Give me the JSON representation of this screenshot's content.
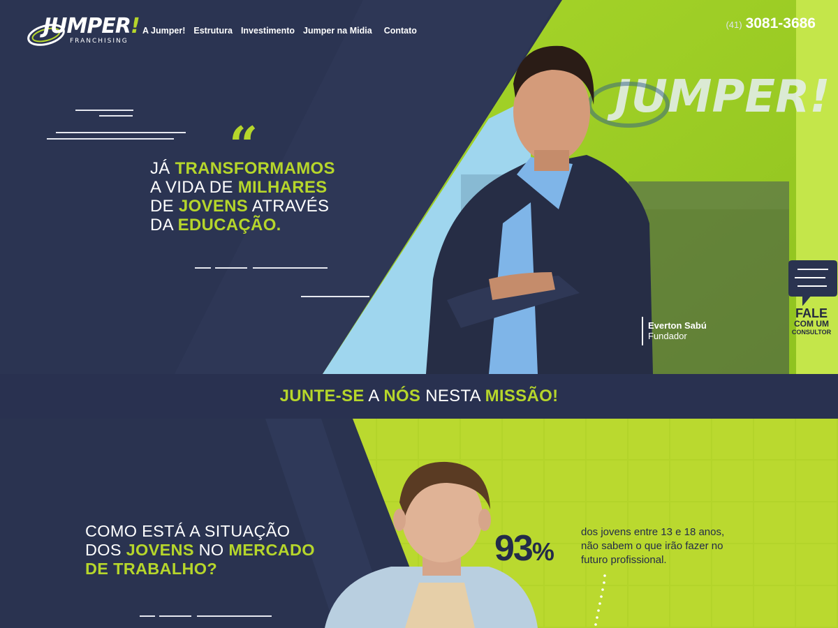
{
  "brand": {
    "name": "JUMPER",
    "bang": "!",
    "sub": "FRANCHISING",
    "colors": {
      "navy": "#2b3452",
      "lime": "#b6d62b",
      "dark": "#232b49"
    }
  },
  "nav": {
    "items": [
      "A Jumper!",
      "Estrutura",
      "Investimento",
      "Jumper na Midia",
      "Contato"
    ]
  },
  "phone": {
    "ddd": "(41)",
    "number": "3081-3686"
  },
  "hero": {
    "line1_a": "JÁ ",
    "line1_b": "TRANSFORMAMOS",
    "line2_a": "A VIDA DE ",
    "line2_b": "MILHARES",
    "line3_a": "DE ",
    "line3_b": "JOVENS",
    "line3_c": " ATRAVÉS",
    "line4_a": "DA ",
    "line4_b": "EDUCAÇÃO."
  },
  "founder": {
    "name": "Everton Sabú",
    "role": "Fundador"
  },
  "cta": {
    "fale": "FALE",
    "com": "COM UM",
    "consultor": "CONSULTOR"
  },
  "mission": {
    "a": "JUNTE-SE",
    "b": " A ",
    "c": "NÓS",
    "d": " NESTA ",
    "e": "MISSÃO!"
  },
  "section2": {
    "line1": "COMO ESTÁ A SITUAÇÃO",
    "line2_a": "DOS ",
    "line2_b": "JOVENS",
    "line2_c": " NO ",
    "line2_d": "MERCADO",
    "line3": "DE TRABALHO?",
    "stat_value": "93",
    "stat_unit": "%",
    "stat_desc_1": "dos jovens entre 13 e 18 anos,",
    "stat_desc_2": "não sabem o que irão fazer no",
    "stat_desc_3": "futuro profissional."
  }
}
